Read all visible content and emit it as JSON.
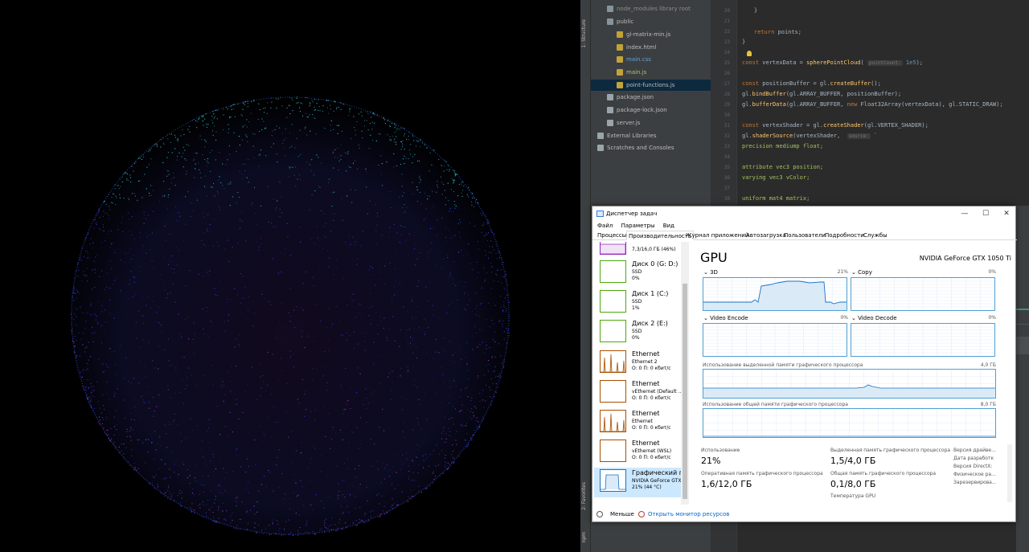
{
  "ide": {
    "vertical_tabs": [
      "1: Structure",
      "2: Favorites",
      "npm"
    ],
    "tree": [
      {
        "label": "node_modules  library root",
        "indent": 1,
        "color": "#8a8a8a"
      },
      {
        "label": "public",
        "indent": 1,
        "color": "#bbbbbb"
      },
      {
        "label": "gl-matrix-min.js",
        "indent": 2,
        "color": "#bbbbbb"
      },
      {
        "label": "index.html",
        "indent": 2,
        "color": "#bbbbbb"
      },
      {
        "label": "main.css",
        "indent": 2,
        "color": "#6a9fd8"
      },
      {
        "label": "main.js",
        "indent": 2,
        "color": "#a8c56a"
      },
      {
        "label": "point-functions.js",
        "indent": 2,
        "color": "#bbbbbb"
      },
      {
        "label": "package.json",
        "indent": 1,
        "color": "#bbbbbb"
      },
      {
        "label": "package-lock.json",
        "indent": 1,
        "color": "#bbbbbb"
      },
      {
        "label": "server.js",
        "indent": 1,
        "color": "#bbbbbb"
      },
      {
        "label": "External Libraries",
        "indent": 0,
        "color": "#bbbbbb"
      },
      {
        "label": "Scratches and Consoles",
        "indent": 0,
        "color": "#bbbbbb"
      }
    ],
    "line_numbers": [
      "20",
      "21",
      "22",
      "23",
      "24",
      "25",
      "26",
      "27",
      "28",
      "29",
      "30",
      "31",
      "32",
      "33",
      "34",
      "35",
      "36",
      "37",
      "38"
    ],
    "code": {
      "l20": "}",
      "l22_kw": "return",
      "l22": " points;",
      "l23": "}",
      "l25_kw": "const",
      "l25_a": " vertexData = ",
      "l25_fn": "spherePointCloud",
      "l25_hint": "pointCount:",
      "l25_num": " 1e5",
      "l25_end": ");",
      "l27_kw": "const",
      "l27_a": " positionBuffer = gl.",
      "l27_fn": "createBuffer",
      "l27_end": "();",
      "l28_a": "gl.",
      "l28_fn": "bindBuffer",
      "l28_end": "(gl.ARRAY_BUFFER, positionBuffer);",
      "l29_a": "gl.",
      "l29_fn": "bufferData",
      "l29_b": "(gl.ARRAY_BUFFER, ",
      "l29_kw": "new",
      "l29_end": " Float32Array(vertexData), gl.STATIC_DRAW);",
      "l31_kw": "const",
      "l31_a": " vertexShader = gl.",
      "l31_fn": "createShader",
      "l31_end": "(gl.VERTEX_SHADER);",
      "l32_a": "gl.",
      "l32_fn": "shaderSource",
      "l32_b": "(vertexShader,  ",
      "l32_hint": "source:",
      "l32_end": " `",
      "l33": "precision mediump float;",
      "l35": "attribute vec3 position;",
      "l36": "varying vec3 vColor;",
      "l38": "uniform mat4 matrix;"
    }
  },
  "tm": {
    "title": "Диспетчер задач",
    "win_buttons": [
      "—",
      "☐",
      "✕"
    ],
    "menu": [
      "Файл",
      "Параметры",
      "Вид"
    ],
    "tabs": [
      "Процессы",
      "Производительность",
      "Журнал приложений",
      "Автозагрузка",
      "Пользователи",
      "Подробности",
      "Службы"
    ],
    "active_tab": 1,
    "resources": [
      {
        "name": "",
        "sub1": "7,3/16,0 ГБ (46%)",
        "sub2": "",
        "color": "#9528b4",
        "kind": "mem"
      },
      {
        "name": "Диск 0 (G: D:)",
        "sub1": "SSD",
        "sub2": "0%",
        "color": "#4da60c",
        "kind": "disk"
      },
      {
        "name": "Диск 1 (C:)",
        "sub1": "SSD",
        "sub2": "1%",
        "color": "#4da60c",
        "kind": "disk"
      },
      {
        "name": "Диск 2 (E:)",
        "sub1": "SSD",
        "sub2": "0%",
        "color": "#4da60c",
        "kind": "disk"
      },
      {
        "name": "Ethernet",
        "sub1": "Ethernet 2",
        "sub2": "О: 0 П: 0 кбит/с",
        "color": "#a74f01",
        "kind": "eth-busy"
      },
      {
        "name": "Ethernet",
        "sub1": "vEthernet (Default ...",
        "sub2": "О: 0 П: 0 кбит/с",
        "color": "#a74f01",
        "kind": "eth"
      },
      {
        "name": "Ethernet",
        "sub1": "Ethernet",
        "sub2": "О: 0 П: 0 кбит/с",
        "color": "#a74f01",
        "kind": "eth-busy"
      },
      {
        "name": "Ethernet",
        "sub1": "vEthernet (WSL)",
        "sub2": "О: 0 П: 0 кбит/с",
        "color": "#a74f01",
        "kind": "eth"
      },
      {
        "name": "Графический п",
        "sub1": "NVIDIA GeForce GTX",
        "sub2": "21% (44 °C)",
        "color": "#1a73c4",
        "kind": "gpu"
      }
    ],
    "gpu": {
      "title": "GPU",
      "model": "NVIDIA GeForce GTX 1050 Ti",
      "engines": [
        {
          "label": "3D",
          "pct": "21%"
        },
        {
          "label": "Copy",
          "pct": "0%"
        },
        {
          "label": "Video Encode",
          "pct": "0%"
        },
        {
          "label": "Video Decode",
          "pct": "0%"
        }
      ],
      "dedicated_label": "Использование выделенной памяти графического процессора",
      "dedicated_max": "4,0 ГБ",
      "shared_label": "Использование общей памяти графического процессора",
      "shared_max": "8,0 ГБ",
      "stats": {
        "usage_label": "Использование",
        "usage_value": "21%",
        "ram_label": "Оперативная память графического процессора",
        "ram_value": "1,6/12,0 ГБ",
        "ded_label": "Выделенная память графического процессора",
        "ded_value": "1,5/4,0 ГБ",
        "shared_mem_label": "Общая память графического процессора",
        "shared_mem_value": "0,1/8,0 ГБ",
        "temp_label": "Температура GPU",
        "info_labels": [
          "Версия драйве...",
          "Дата разработк",
          "Версия DirectX:",
          "Физическое ра...",
          "Зарезервирова..."
        ]
      }
    },
    "footer": {
      "less": "Меньше",
      "monitor": "Открыть монитор ресурсов"
    }
  },
  "colors": {
    "sphere_cyan": "#35c6c6",
    "sphere_blue": "#2e3fd6",
    "sphere_magenta": "#a43ac2",
    "graph_border": "#4f9fd6",
    "graph_fill": "#dbeaf7"
  }
}
